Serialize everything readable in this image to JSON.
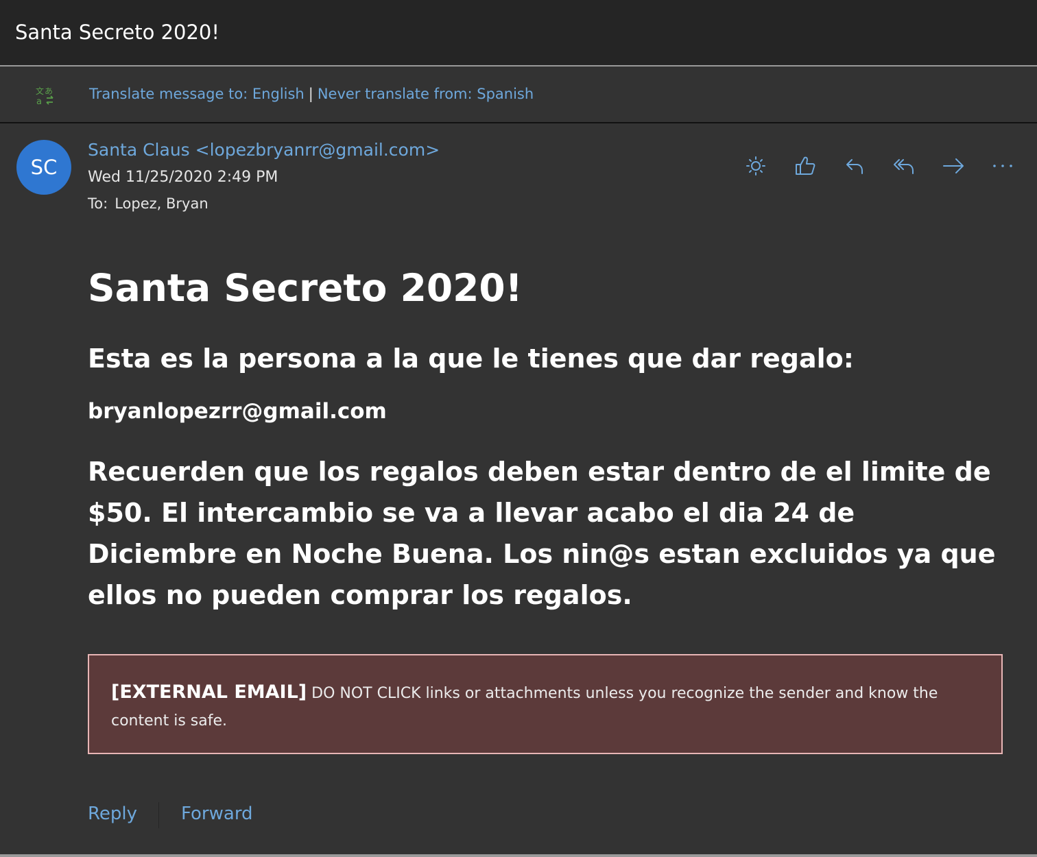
{
  "window": {
    "title": "Santa Secreto 2020!"
  },
  "translate_bar": {
    "translate_link": "Translate message to: English",
    "separator": "|",
    "never_link": "Never translate from: Spanish",
    "icon": "translate-icon"
  },
  "header": {
    "avatar_initials": "SC",
    "avatar_color": "#2f77d1",
    "sender": "Santa Claus <lopezbryanrr@gmail.com>",
    "date": "Wed 11/25/2020 2:49 PM",
    "to_label": "To:",
    "to_value": "Lopez, Bryan",
    "actions": [
      {
        "name": "brightness",
        "icon": "sun-icon"
      },
      {
        "name": "like",
        "icon": "thumbs-up-icon"
      },
      {
        "name": "reply",
        "icon": "reply-icon"
      },
      {
        "name": "reply-all",
        "icon": "reply-all-icon"
      },
      {
        "name": "forward",
        "icon": "forward-arrow-icon"
      },
      {
        "name": "more",
        "icon": "more-icon"
      }
    ]
  },
  "body": {
    "heading": "Santa Secreto 2020!",
    "subheading": "Esta es la persona a la que le tienes que dar regalo:",
    "target_email": "bryanlopezrr@gmail.com",
    "paragraph": "Recuerden que los regalos deben estar dentro de el limite de $50. El intercambio se va a llevar acabo el dia 24 de Diciembre en Noche Buena. Los nin@s estan excluidos ya que ellos no pueden comprar los regalos."
  },
  "warning": {
    "label": "[EXTERNAL EMAIL]",
    "text": " DO NOT CLICK links or attachments unless you recognize the sender and know the content is safe.",
    "background": "#5c3a3a",
    "border": "#e8b6b6"
  },
  "footer": {
    "reply": "Reply",
    "forward": "Forward"
  },
  "colors": {
    "accent": "#6ea8dc",
    "background": "#333333",
    "title_bar": "#252525"
  }
}
